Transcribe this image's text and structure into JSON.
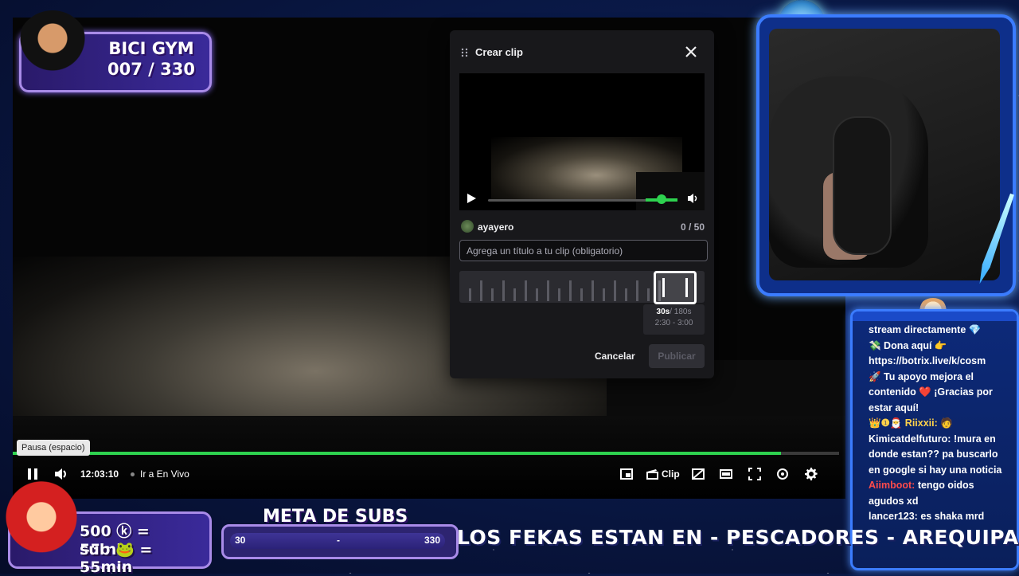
{
  "overlay": {
    "bici_title": "BICI GYM",
    "bici_count": "007 / 330",
    "sub_line1": "500 ⓚ = 55min",
    "sub_line2": "sub 🐸 = 55min",
    "meta_title": "META DE SUBS",
    "meta_min": "30",
    "meta_mid": "-",
    "meta_max": "330",
    "marquee": "LOS FEKAS ESTAN EN - PESCADORES - AREQUIPA"
  },
  "player": {
    "tooltip": "Pausa (espacio)",
    "time": "12:03:10",
    "live_link": "Ir a En Vivo",
    "clip_label": "Clip",
    "progress_fraction": 0.93
  },
  "clip_modal": {
    "title": "Crear clip",
    "username": "ayayero",
    "counter": "0 / 50",
    "title_placeholder": "Agrega un título a tu clip (obligatorio)",
    "duration_selected": "30s",
    "duration_max": "/ 180s",
    "range": "2:30 - 3:00",
    "cancel_label": "Cancelar",
    "publish_label": "Publicar"
  },
  "chat": {
    "messages": [
      {
        "user": "",
        "text": "stream directamente 💎"
      },
      {
        "user": "",
        "text": "💸 Dona aquí 👉 https://botrix.live/k/cosm"
      },
      {
        "user": "",
        "text": "🚀 Tu apoyo mejora el contenido ❤️ ¡Gracias por estar aquí!"
      },
      {
        "user": "👑❶🎅 Riixxii:",
        "text": "🧑"
      },
      {
        "user": "Kimicatdelfuturo:",
        "text": "!mura en donde estan?? pa buscarlo en google si hay una noticia"
      },
      {
        "user": "Aiimboot:",
        "text": "tengo oidos agudos xd"
      },
      {
        "user": "lancer123:",
        "text": "es shaka mrd"
      }
    ]
  },
  "colors": {
    "accent_green": "#2ed24f",
    "frame_blue": "#3b7cff",
    "frame_purple": "#a98be8"
  }
}
